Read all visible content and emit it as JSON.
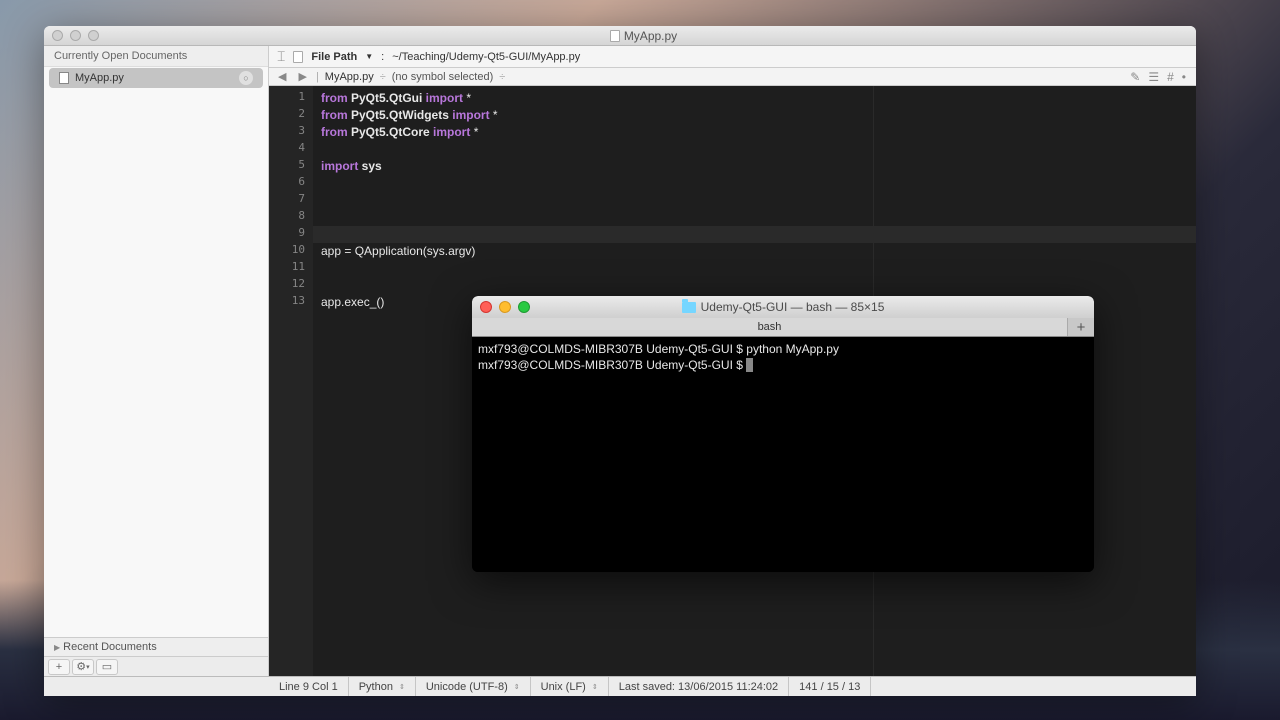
{
  "window_title": "MyApp.py",
  "sidebar": {
    "open_header": "Currently Open Documents",
    "open_file": "MyApp.py",
    "recent_header": "Recent Documents"
  },
  "path_bar": {
    "label": "File Path",
    "path": "~/Teaching/Udemy-Qt5-GUI/MyApp.py"
  },
  "jump_bar": {
    "file": "MyApp.py",
    "symbol": "(no symbol selected)"
  },
  "code": {
    "lines": [
      {
        "n": "1",
        "tokens": [
          [
            "kw",
            "from "
          ],
          [
            "mod",
            "PyQt5.QtGui"
          ],
          [
            "kw",
            " import "
          ],
          [
            "plain",
            "*"
          ]
        ]
      },
      {
        "n": "2",
        "tokens": [
          [
            "kw",
            "from "
          ],
          [
            "mod",
            "PyQt5.QtWidgets"
          ],
          [
            "kw",
            " import "
          ],
          [
            "plain",
            "*"
          ]
        ]
      },
      {
        "n": "3",
        "tokens": [
          [
            "kw",
            "from "
          ],
          [
            "mod",
            "PyQt5.QtCore"
          ],
          [
            "kw",
            " import "
          ],
          [
            "plain",
            "*"
          ]
        ]
      },
      {
        "n": "4",
        "tokens": []
      },
      {
        "n": "5",
        "tokens": [
          [
            "kw",
            "import "
          ],
          [
            "mod",
            "sys"
          ]
        ]
      },
      {
        "n": "6",
        "tokens": []
      },
      {
        "n": "7",
        "tokens": []
      },
      {
        "n": "8",
        "tokens": []
      },
      {
        "n": "9",
        "tokens": [],
        "hl": true
      },
      {
        "n": "10",
        "tokens": [
          [
            "plain",
            "app = QApplication(sys.argv)"
          ]
        ]
      },
      {
        "n": "11",
        "tokens": []
      },
      {
        "n": "12",
        "tokens": []
      },
      {
        "n": "13",
        "tokens": [
          [
            "plain",
            "app.exec_()"
          ]
        ]
      }
    ]
  },
  "status": {
    "pos": "Line 9 Col 1",
    "lang": "Python",
    "encoding": "Unicode (UTF-8)",
    "lineend": "Unix (LF)",
    "saved": "Last saved: 13/06/2015 11:24:02",
    "counts": "141 / 15 / 13"
  },
  "terminal": {
    "title": "Udemy-Qt5-GUI — bash — 85×15",
    "tab": "bash",
    "prompt": "mxf793@COLMDS-MIBR307B Udemy-Qt5-GUI $",
    "command": "python MyApp.py"
  }
}
